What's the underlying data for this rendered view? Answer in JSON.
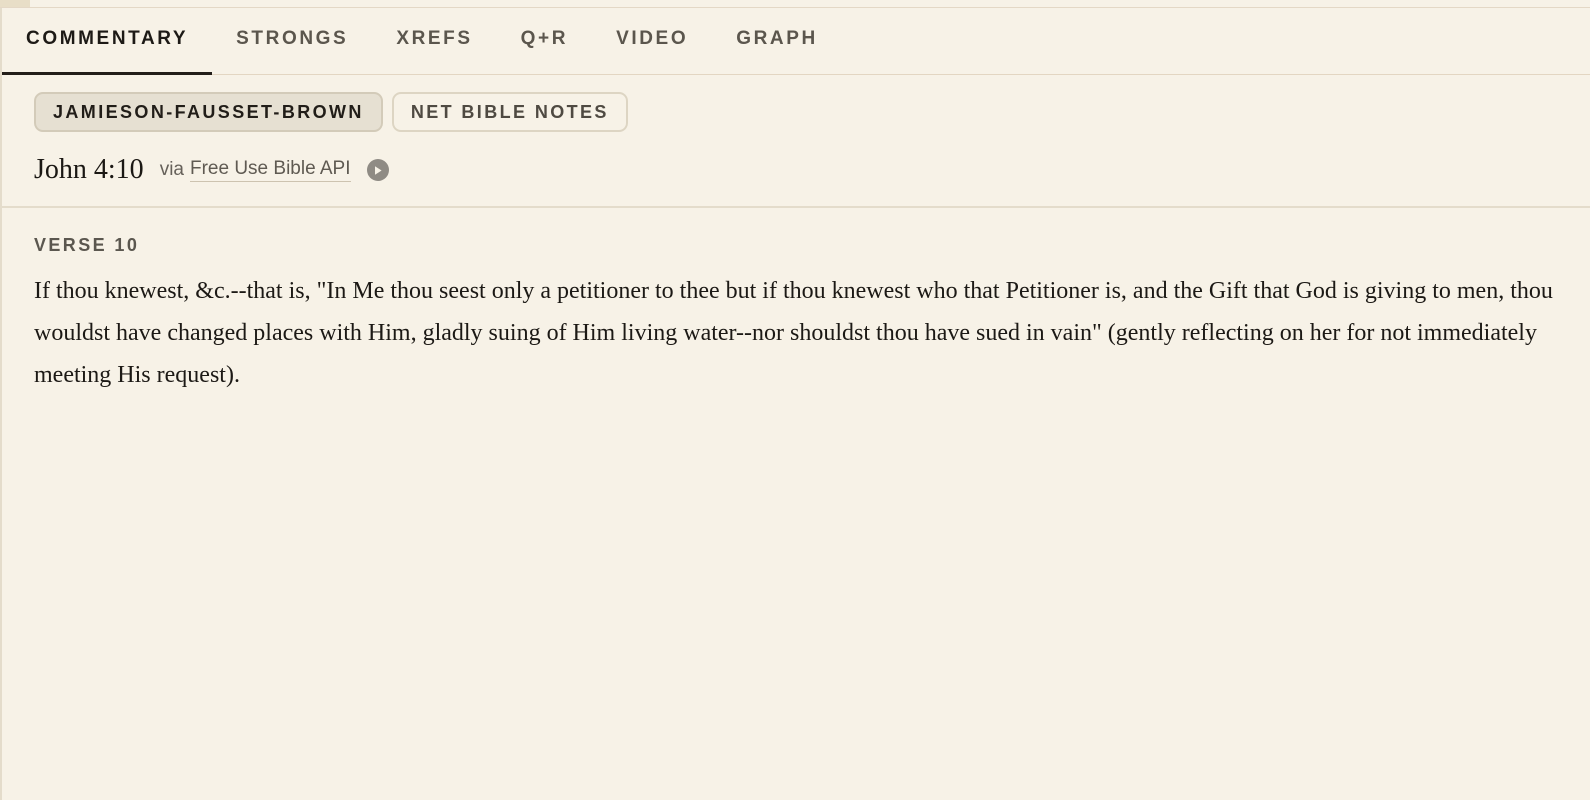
{
  "tabs": [
    {
      "label": "COMMENTARY",
      "active": true
    },
    {
      "label": "STRONGS",
      "active": false
    },
    {
      "label": "XREFS",
      "active": false
    },
    {
      "label": "Q+R",
      "active": false
    },
    {
      "label": "VIDEO",
      "active": false
    },
    {
      "label": "GRAPH",
      "active": false
    }
  ],
  "sources": [
    {
      "label": "JAMIESON-FAUSSET-BROWN",
      "selected": true
    },
    {
      "label": "NET BIBLE NOTES",
      "selected": false
    }
  ],
  "reference": {
    "title": "John 4:10",
    "via_label": "via",
    "source_link": "Free Use Bible API",
    "play_icon": "play-circle-icon"
  },
  "commentary": {
    "verse_label": "VERSE 10",
    "text": "If thou knewest, &c.--that is, \"In Me thou seest only a petitioner to thee but if thou knewest who that Petitioner is, and the Gift that God is giving to men, thou wouldst have changed places with Him, gladly suing of Him living water--nor shouldst thou have sued in vain\" (gently reflecting on her for not immediately meeting His request)."
  },
  "colors": {
    "background": "#f7f2e7",
    "active_tab_underline": "#231e19",
    "selected_pill": "#e6e0d2"
  }
}
